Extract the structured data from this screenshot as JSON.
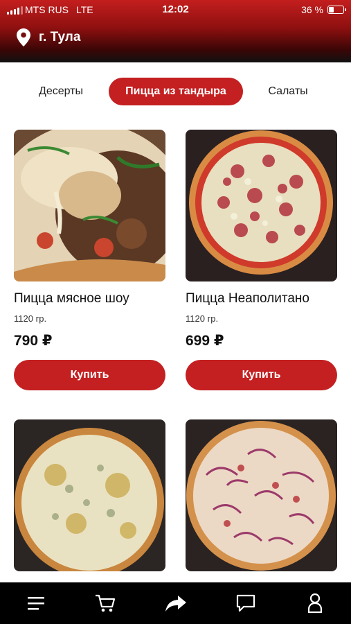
{
  "status_bar": {
    "carrier": "MTS RUS",
    "network": "LTE",
    "time": "12:02",
    "battery_percent": "36 %",
    "battery_level": 0.36
  },
  "header": {
    "city": "г. Тула",
    "location_icon": "map-pin-icon"
  },
  "tabs": [
    {
      "label": "Десерты",
      "active": false
    },
    {
      "label": "Пицца из тандыра",
      "active": true
    },
    {
      "label": "Салаты",
      "active": false
    }
  ],
  "colors": {
    "accent": "#c42021",
    "header_top": "#c41e1e",
    "nav_bg": "#000000"
  },
  "products": [
    {
      "name": "Пицца мясное шоу",
      "weight": "1120 гр.",
      "price": "790 ₽",
      "buy_label": "Купить"
    },
    {
      "name": "Пицца Неаполитано",
      "weight": "1120 гр.",
      "price": "699 ₽",
      "buy_label": "Купить"
    },
    {
      "name": "",
      "weight": "",
      "price": "",
      "buy_label": ""
    },
    {
      "name": "",
      "weight": "",
      "price": "",
      "buy_label": ""
    }
  ],
  "bottom_nav": [
    {
      "icon": "menu-icon"
    },
    {
      "icon": "cart-icon"
    },
    {
      "icon": "share-icon"
    },
    {
      "icon": "chat-icon"
    },
    {
      "icon": "profile-icon"
    }
  ]
}
